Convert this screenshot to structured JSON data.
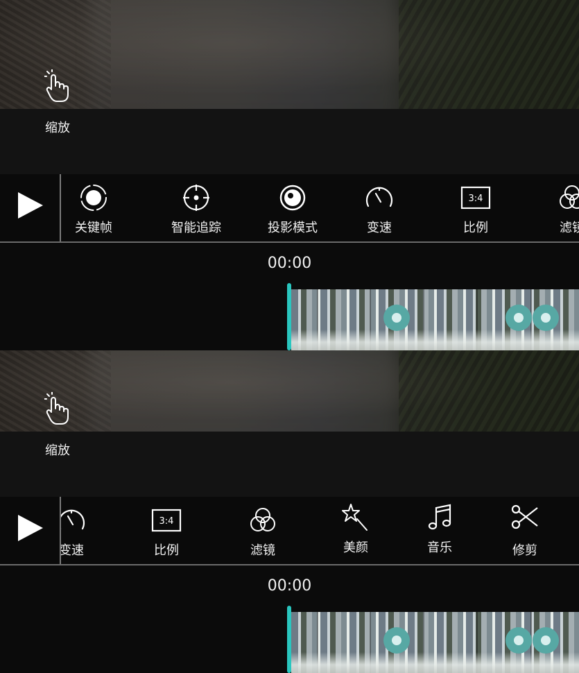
{
  "panels": [
    {
      "gesture_label": "缩放",
      "gesture_icon": "pinch-zoom-hand-icon",
      "play_icon": "play-icon",
      "timecode": "00:00",
      "tools": [
        {
          "label": "关键帧",
          "icon": "keyframe-icon"
        },
        {
          "label": "智能追踪",
          "icon": "crosshair-target-icon"
        },
        {
          "label": "投影模式",
          "icon": "projection-mode-icon"
        },
        {
          "label": "变速",
          "icon": "speedometer-icon"
        },
        {
          "label": "比例",
          "icon": "aspect-ratio-icon",
          "icon_text": "3:4"
        },
        {
          "label": "滤镜",
          "icon": "filter-circles-icon"
        }
      ]
    },
    {
      "gesture_label": "缩放",
      "gesture_icon": "pinch-zoom-hand-icon",
      "play_icon": "play-icon",
      "timecode": "00:00",
      "tools": [
        {
          "label": "变速",
          "icon": "speedometer-icon"
        },
        {
          "label": "比例",
          "icon": "aspect-ratio-icon",
          "icon_text": "3:4"
        },
        {
          "label": "滤镜",
          "icon": "filter-circles-icon"
        },
        {
          "label": "美颜",
          "icon": "magic-wand-star-icon"
        },
        {
          "label": "音乐",
          "icon": "music-note-icon"
        },
        {
          "label": "修剪",
          "icon": "scissors-icon"
        }
      ]
    }
  ],
  "colors": {
    "accent_playhead": "#29c6bf",
    "keyframe_marker": "#57a8a4"
  }
}
